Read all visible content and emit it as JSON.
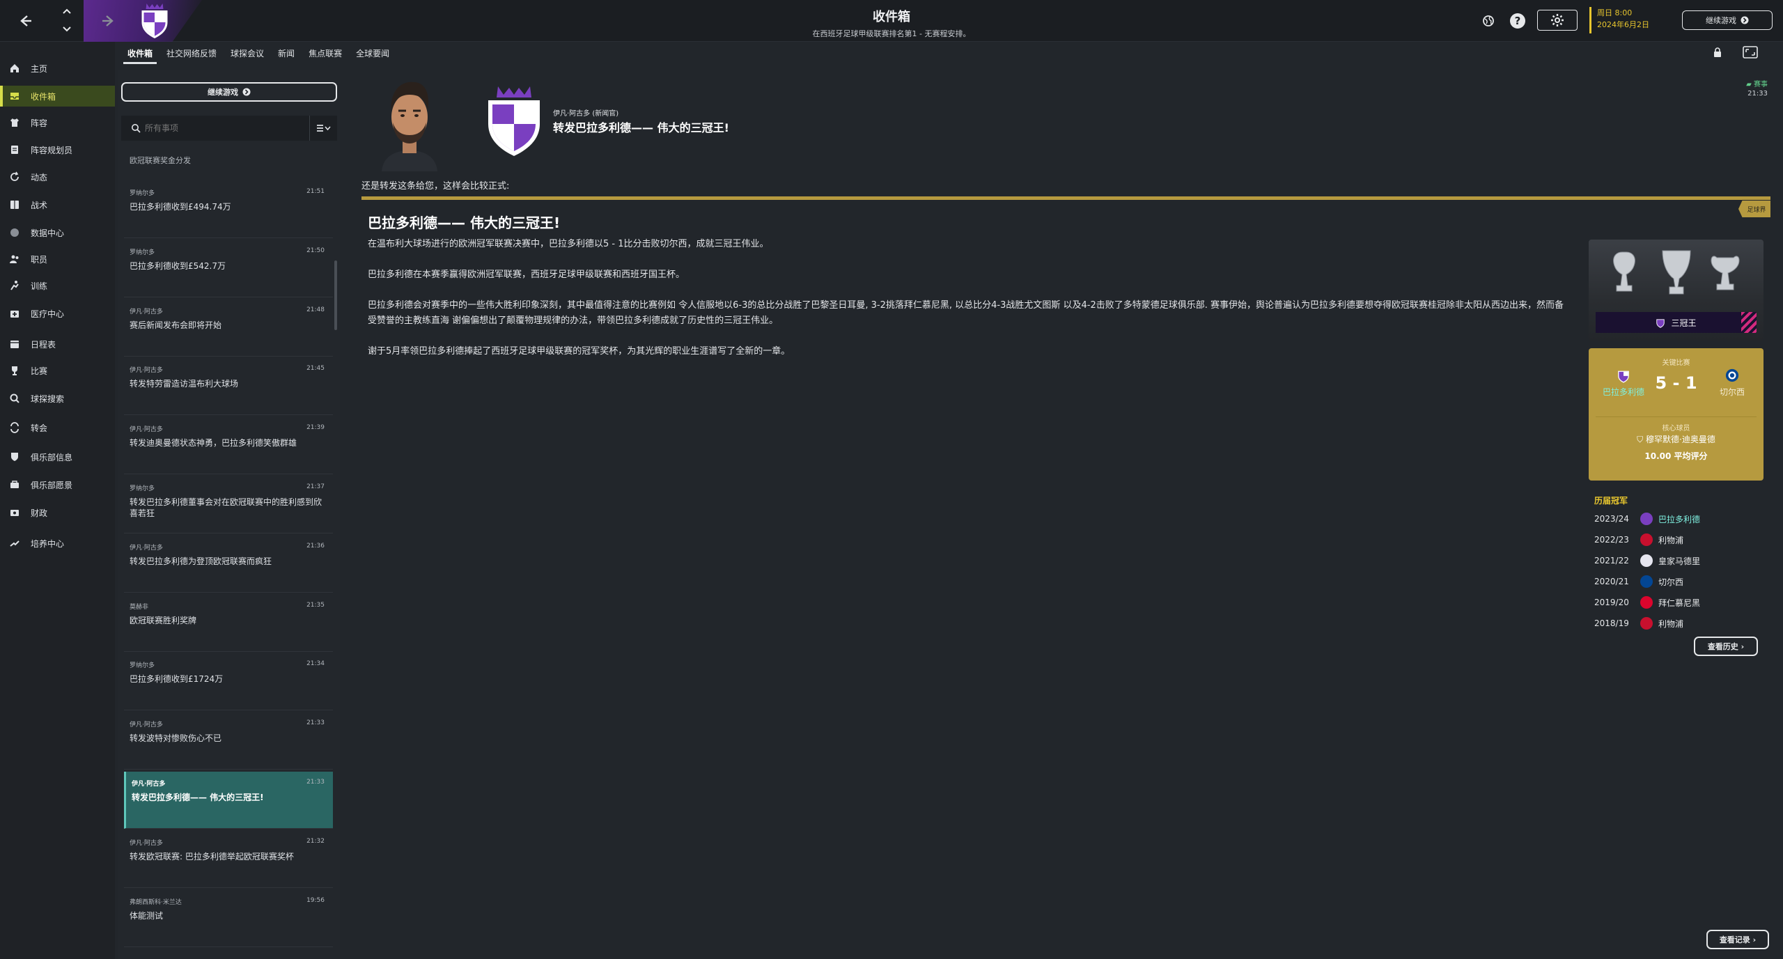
{
  "header": {
    "title": "收件箱",
    "subtitle": "在西班牙足球甲级联赛排名第1 - 无赛程安排。",
    "date_line1": "周日 8:00",
    "date_line2": "2024年6月2日",
    "continue_label": "继续游戏"
  },
  "sidebar": {
    "items": [
      {
        "label": "主页",
        "icon": "home-icon"
      },
      {
        "label": "收件箱",
        "icon": "inbox-icon"
      },
      {
        "label": "阵容",
        "icon": "shirt-icon"
      },
      {
        "label": "阵容规划员",
        "icon": "clipboard-icon"
      },
      {
        "label": "动态",
        "icon": "refresh-icon"
      },
      {
        "label": "战术",
        "icon": "tactics-icon"
      },
      {
        "label": "数据中心",
        "icon": "data-icon"
      },
      {
        "label": "职员",
        "icon": "staff-icon"
      },
      {
        "label": "训练",
        "icon": "training-icon"
      },
      {
        "label": "医疗中心",
        "icon": "medical-icon"
      },
      {
        "label": "日程表",
        "icon": "calendar-icon"
      },
      {
        "label": "比赛",
        "icon": "trophy-icon"
      },
      {
        "label": "球探搜索",
        "icon": "search-icon"
      },
      {
        "label": "转会",
        "icon": "transfer-icon"
      },
      {
        "label": "俱乐部信息",
        "icon": "shield-icon"
      },
      {
        "label": "俱乐部愿景",
        "icon": "vision-icon"
      },
      {
        "label": "财政",
        "icon": "finance-icon"
      },
      {
        "label": "培养中心",
        "icon": "development-icon"
      }
    ]
  },
  "tabs": [
    "收件箱",
    "社交网络反馈",
    "球探会议",
    "新闻",
    "焦点联赛",
    "全球要闻"
  ],
  "list": {
    "continue_label": "继续游戏",
    "search_placeholder": "所有事项",
    "partial_item": "欧冠联赛奖金分发",
    "messages": [
      {
        "sender": "罗纳尔多",
        "time": "21:51",
        "subject": "巴拉多利德收到£494.74万"
      },
      {
        "sender": "罗纳尔多",
        "time": "21:50",
        "subject": "巴拉多利德收到£542.7万"
      },
      {
        "sender": "伊凡·阿古多",
        "time": "21:48",
        "subject": "赛后新闻发布会即将开始"
      },
      {
        "sender": "伊凡·阿古多",
        "time": "21:45",
        "subject": "转发特劳雷造访温布利大球场"
      },
      {
        "sender": "伊凡·阿古多",
        "time": "21:39",
        "subject": "转发迪奥曼德状态神勇，巴拉多利德笑傲群雄"
      },
      {
        "sender": "罗纳尔多",
        "time": "21:37",
        "subject": "转发巴拉多利德董事会对在欧冠联赛中的胜利感到欣喜若狂"
      },
      {
        "sender": "伊凡·阿古多",
        "time": "21:36",
        "subject": "转发巴拉多利德为登顶欧冠联赛而疯狂"
      },
      {
        "sender": "莫赫非",
        "time": "21:35",
        "subject": "欧冠联赛胜利奖牌"
      },
      {
        "sender": "罗纳尔多",
        "time": "21:34",
        "subject": "巴拉多利德收到£1724万"
      },
      {
        "sender": "伊凡·阿古多",
        "time": "21:33",
        "subject": "转发波特对惨败伤心不已"
      },
      {
        "sender": "伊凡·阿古多",
        "time": "21:33",
        "subject": "转发巴拉多利德—— 伟大的三冠王!"
      },
      {
        "sender": "伊凡·阿古多",
        "time": "21:32",
        "subject": "转发欧冠联赛: 巴拉多利德举起欧冠联赛奖杯"
      },
      {
        "sender": "弗朗西斯科·米兰达",
        "time": "19:56",
        "subject": "体能测试"
      }
    ]
  },
  "message": {
    "sender": "伊凡·阿古多 (新闻官)",
    "subject": "转发巴拉多利德—— 伟大的三冠王!",
    "badge_label": "赛事",
    "badge_time": "21:33",
    "intro": "还是转发这条给您，这样会比较正式:",
    "ribbon": "足球界",
    "article_title": "巴拉多利德—— 伟大的三冠王!",
    "paragraphs": [
      "在温布利大球场进行的欧洲冠军联赛决赛中，巴拉多利德以5 - 1比分击败切尔西，成就三冠王伟业。",
      "巴拉多利德在本赛季赢得欧洲冠军联赛，西班牙足球甲级联赛和西班牙国王杯。",
      "巴拉多利德会对赛季中的一些伟大胜利印象深刻，其中最值得注意的比赛例如 令人信服地以6-3的总比分战胜了巴黎圣日耳曼, 3-2挑落拜仁慕尼黑, 以总比分4-3战胜尤文图斯 以及4-2击败了多特蒙德足球俱乐部. 赛事伊始，舆论普遍认为巴拉多利德要想夺得欧冠联赛桂冠除非太阳从西边出来，然而备受赞誉的主教练直海 谢偏偏想出了颠覆物理规律的办法，带领巴拉多利德成就了历史性的三冠王伟业。",
      "谢于5月率领巴拉多利德捧起了西班牙足球甲级联赛的冠军奖杯，为其光辉的职业生涯谱写了全新的一章。"
    ]
  },
  "trophy_card": {
    "label": "三冠王"
  },
  "key_match": {
    "label": "关键比赛",
    "home": "巴拉多利德",
    "away": "切尔西",
    "score": "5 - 1",
    "motm_label": "核心球员",
    "motm_name": "穆罕默德·迪奥曼德",
    "rating": "10.00 平均评分"
  },
  "history": {
    "title": "历届冠军",
    "rows": [
      {
        "season": "2023/24",
        "team": "巴拉多利德",
        "color": "#7a3fc0"
      },
      {
        "season": "2022/23",
        "team": "利物浦",
        "color": "#c8102e"
      },
      {
        "season": "2021/22",
        "team": "皇家马德里",
        "color": "#e6e6f0"
      },
      {
        "season": "2020/21",
        "team": "切尔西",
        "color": "#034694"
      },
      {
        "season": "2019/20",
        "team": "拜仁慕尼黑",
        "color": "#dc052d"
      },
      {
        "season": "2018/19",
        "team": "利物浦",
        "color": "#c8102e"
      }
    ],
    "button": "查看历史 ›"
  },
  "records_button": "查看记录 ›",
  "colors": {
    "accent": "#e8c62e",
    "gold": "#b69a3f",
    "teal": "#2a6663",
    "club_purple": "#7a3fc0"
  }
}
